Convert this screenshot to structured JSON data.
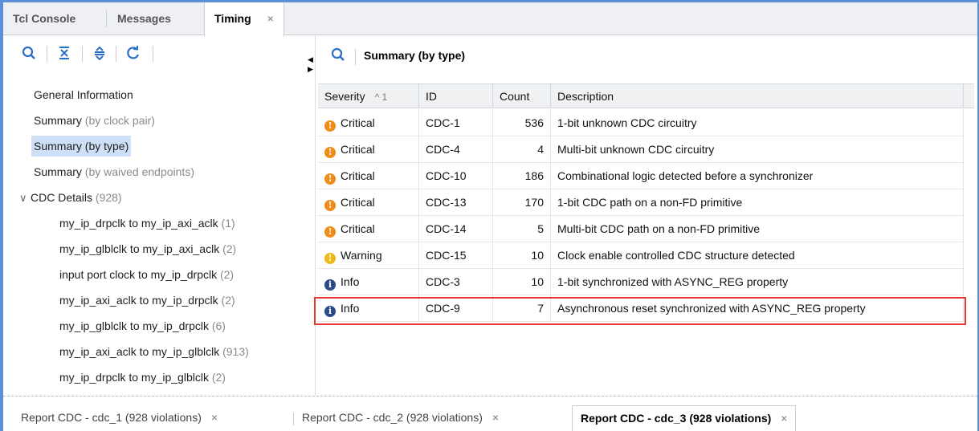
{
  "top_tabs": [
    {
      "label": "Tcl Console"
    },
    {
      "label": "Messages"
    },
    {
      "label": "Timing",
      "close": "×"
    }
  ],
  "right_header": {
    "title": "Summary (by type)"
  },
  "tree": {
    "general": "General Information",
    "by_clock_pair": {
      "main": "Summary",
      "dim": " (by clock pair)"
    },
    "by_type": "Summary (by type)",
    "by_waived": {
      "main": "Summary",
      "dim": " (by waived endpoints)"
    },
    "cdc_details": {
      "main": "CDC Details",
      "dim": " (928)"
    },
    "children": [
      {
        "main": "my_ip_drpclk to my_ip_axi_aclk",
        "dim": " (1)"
      },
      {
        "main": "my_ip_glblclk to my_ip_axi_aclk",
        "dim": " (2)"
      },
      {
        "main": "input port clock to my_ip_drpclk",
        "dim": " (2)"
      },
      {
        "main": "my_ip_axi_aclk to my_ip_drpclk",
        "dim": " (2)"
      },
      {
        "main": "my_ip_glblclk to my_ip_drpclk",
        "dim": " (6)"
      },
      {
        "main": "my_ip_axi_aclk to my_ip_glblclk",
        "dim": " (913)"
      },
      {
        "main": "my_ip_drpclk to my_ip_glblclk",
        "dim": " (2)"
      }
    ]
  },
  "table": {
    "headers": {
      "severity": "Severity",
      "sort": "^ 1",
      "id": "ID",
      "count": "Count",
      "description": "Description"
    },
    "rows": [
      {
        "severity": "Critical",
        "id": "CDC-1",
        "count": "536",
        "description": "1-bit unknown CDC circuitry"
      },
      {
        "severity": "Critical",
        "id": "CDC-4",
        "count": "4",
        "description": "Multi-bit unknown CDC circuitry"
      },
      {
        "severity": "Critical",
        "id": "CDC-10",
        "count": "186",
        "description": "Combinational logic detected before a synchronizer"
      },
      {
        "severity": "Critical",
        "id": "CDC-13",
        "count": "170",
        "description": "1-bit CDC path on a non-FD primitive"
      },
      {
        "severity": "Critical",
        "id": "CDC-14",
        "count": "5",
        "description": "Multi-bit CDC path on a non-FD primitive"
      },
      {
        "severity": "Warning",
        "id": "CDC-15",
        "count": "10",
        "description": "Clock enable controlled CDC structure detected"
      },
      {
        "severity": "Info",
        "id": "CDC-3",
        "count": "10",
        "description": "1-bit synchronized with ASYNC_REG property"
      },
      {
        "severity": "Info",
        "id": "CDC-9",
        "count": "7",
        "description": "Asynchronous reset synchronized with ASYNC_REG property"
      }
    ]
  },
  "bottom_tabs": [
    {
      "label": "Report CDC - cdc_1 (928 violations)",
      "close": "×"
    },
    {
      "label": "Report CDC - cdc_2 (928 violations)",
      "close": "×"
    },
    {
      "label": "Report CDC - cdc_3 (928 violations)",
      "close": "×"
    }
  ],
  "colors": {
    "critical": "#f08c1a",
    "warning": "#f0b81a",
    "info": "#2b4a8b",
    "highlight": "#e53935",
    "accent": "#2a6ec6"
  },
  "icons": {
    "critical": "!",
    "warning": "!",
    "info": "i"
  }
}
